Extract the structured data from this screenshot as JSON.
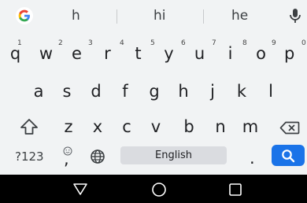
{
  "suggestions": [
    "h",
    "hi",
    "he"
  ],
  "row1": [
    {
      "ch": "q",
      "sup": "1"
    },
    {
      "ch": "w",
      "sup": "2"
    },
    {
      "ch": "e",
      "sup": "3"
    },
    {
      "ch": "r",
      "sup": "4"
    },
    {
      "ch": "t",
      "sup": "5"
    },
    {
      "ch": "y",
      "sup": "6"
    },
    {
      "ch": "u",
      "sup": "7"
    },
    {
      "ch": "i",
      "sup": "8"
    },
    {
      "ch": "o",
      "sup": "9"
    },
    {
      "ch": "p",
      "sup": "0"
    }
  ],
  "row2": [
    "a",
    "s",
    "d",
    "f",
    "g",
    "h",
    "j",
    "k",
    "l"
  ],
  "row3": [
    "z",
    "x",
    "c",
    "v",
    "b",
    "n",
    "m"
  ],
  "bottom": {
    "symbols_label": "?123",
    "comma": ",",
    "space_label": "English",
    "period": "."
  },
  "icons": {
    "google": "google-g-icon",
    "mic": "microphone-icon",
    "shift": "shift-icon",
    "backspace": "backspace-icon",
    "emoji": "emoji-icon",
    "globe": "globe-icon",
    "search": "search-icon",
    "back": "nav-back-icon",
    "home": "nav-home-icon",
    "recents": "nav-recents-icon"
  },
  "colors": {
    "keyboard_bg": "#f1f3f4",
    "accent": "#1a73e8",
    "nav_bg": "#000000"
  }
}
